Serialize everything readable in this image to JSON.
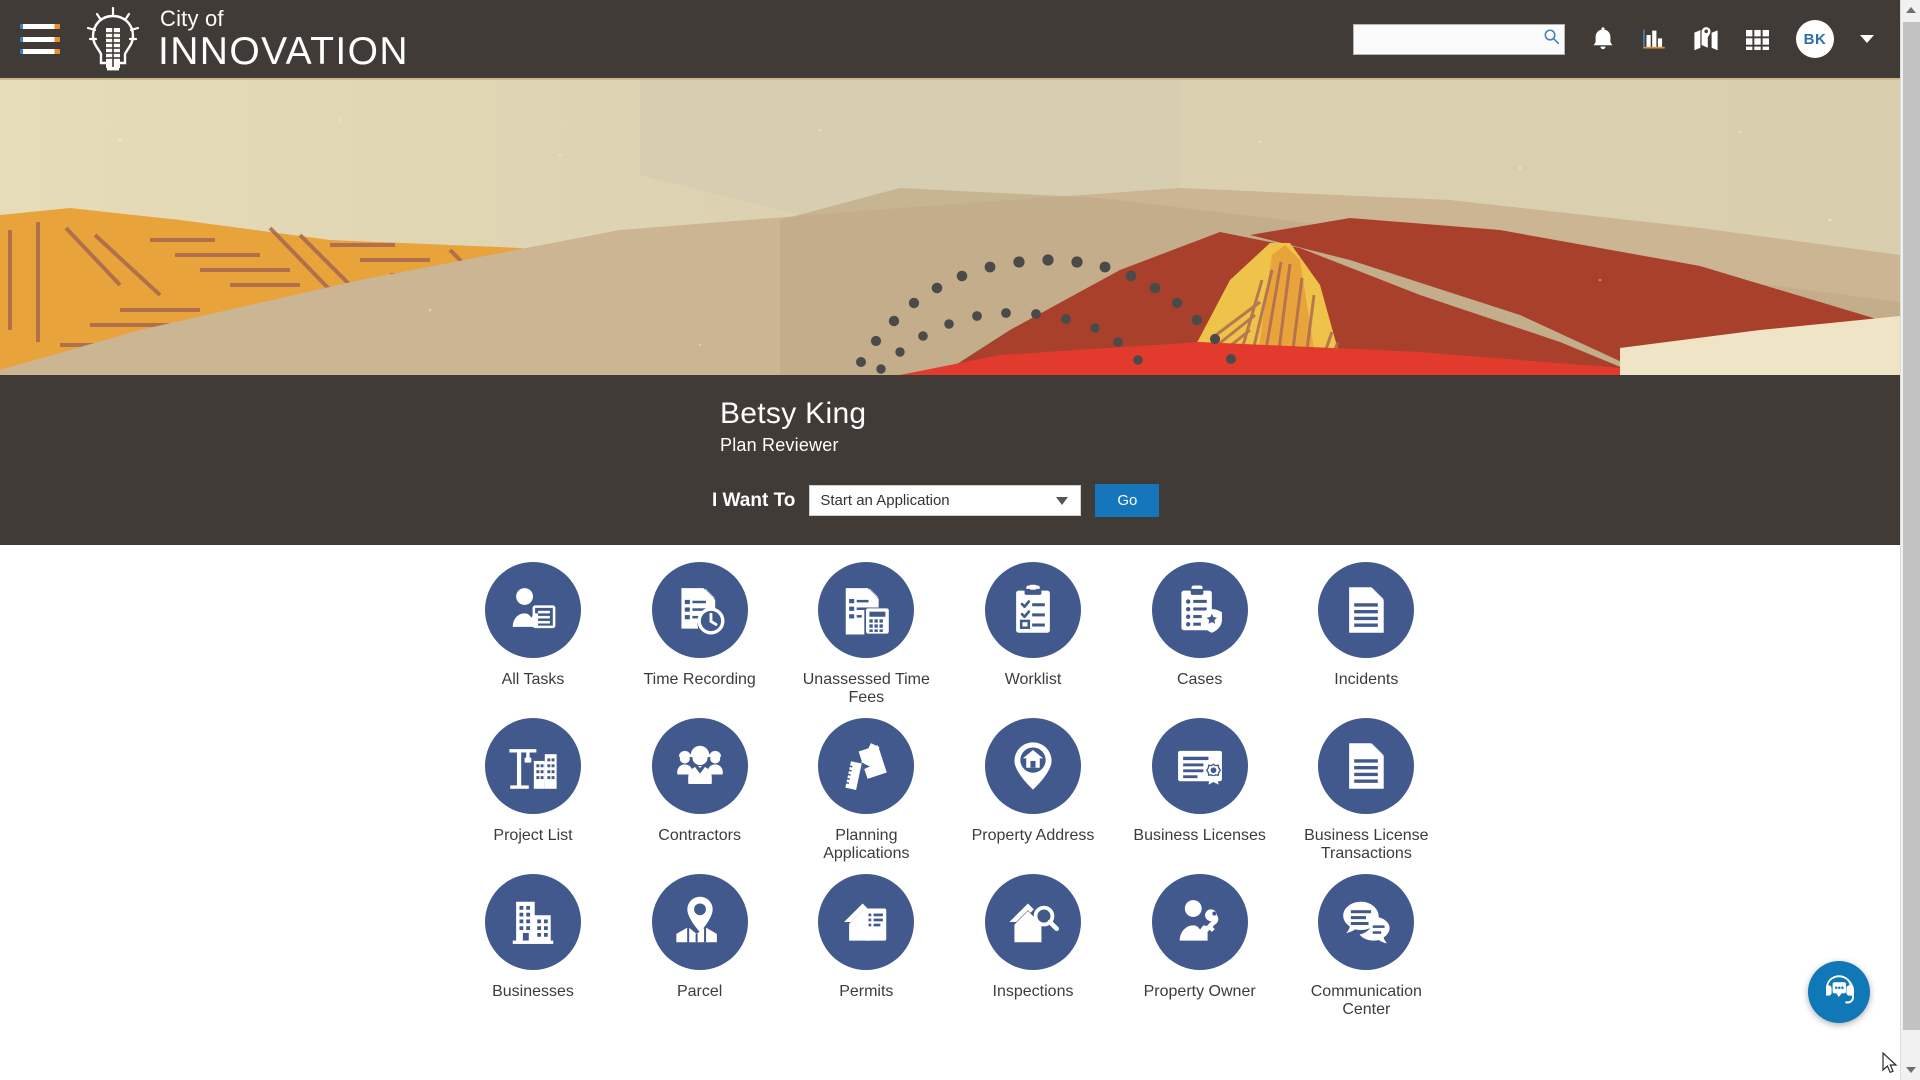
{
  "header": {
    "menu_icon": "hamburger-menu-icon",
    "logo": {
      "icon": "lightbulb-icon",
      "line1": "City of",
      "line2": "INNOVATION"
    },
    "search": {
      "value": "",
      "placeholder": "",
      "icon": "search-icon"
    },
    "icons": [
      {
        "name": "notifications-bell-icon",
        "label": "Notifications"
      },
      {
        "name": "analytics-bar-chart-icon",
        "label": "Analytics"
      },
      {
        "name": "map-pin-icon",
        "label": "Map"
      },
      {
        "name": "app-grid-icon",
        "label": "Apps"
      }
    ],
    "avatar_initials": "BK",
    "avatar_caret": "chevron-down-icon"
  },
  "banner": {
    "alt": "abstract desert mesa landscape illustration"
  },
  "profile": {
    "name": "Betsy King",
    "role": "Plan Reviewer",
    "i_want_to_label": "I Want To",
    "select_value": "Start an Application",
    "select_caret": "chevron-down-icon",
    "go_label": "Go"
  },
  "tiles": [
    {
      "label": "All Tasks",
      "icon": "person-document-icon"
    },
    {
      "label": "Time Recording",
      "icon": "document-clock-icon"
    },
    {
      "label": "Unassessed Time Fees",
      "icon": "document-calculator-icon"
    },
    {
      "label": "Worklist",
      "icon": "clipboard-checklist-icon"
    },
    {
      "label": "Cases",
      "icon": "clipboard-badge-icon"
    },
    {
      "label": "Incidents",
      "icon": "document-lines-icon"
    },
    {
      "label": "Project List",
      "icon": "crane-building-icon"
    },
    {
      "label": "Contractors",
      "icon": "hardhat-workers-icon"
    },
    {
      "label": "Planning Applications",
      "icon": "ruler-pencil-icon"
    },
    {
      "label": "Property Address",
      "icon": "home-map-pin-icon"
    },
    {
      "label": "Business Licenses",
      "icon": "certificate-ribbon-icon"
    },
    {
      "label": "Business License Transactions",
      "icon": "document-lines-icon"
    },
    {
      "label": "Businesses",
      "icon": "office-building-icon"
    },
    {
      "label": "Parcel",
      "icon": "map-pin-parcel-icon"
    },
    {
      "label": "Permits",
      "icon": "house-permit-icon"
    },
    {
      "label": "Inspections",
      "icon": "house-magnifier-icon"
    },
    {
      "label": "Property Owner",
      "icon": "person-key-icon"
    },
    {
      "label": "Communication Center",
      "icon": "chat-bubbles-icon"
    }
  ],
  "chat_widget": {
    "icon": "headset-support-icon",
    "label": "Support Chat"
  },
  "scrollbar": {
    "up_icon": "scroll-up-arrow-icon",
    "down_icon": "scroll-down-arrow-icon"
  },
  "colors": {
    "header_bg": "#403b36",
    "band_bg": "#403b36",
    "tile_circle": "#41598d",
    "go_button": "#1676bc",
    "chat_fab": "#1078b6",
    "header_accent_line": "#cbb98e"
  }
}
